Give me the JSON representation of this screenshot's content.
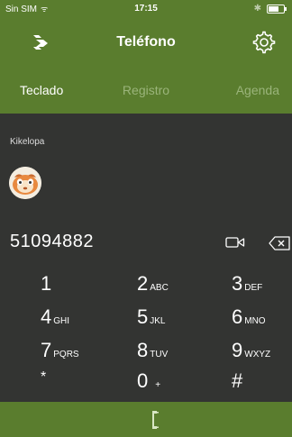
{
  "status_bar": {
    "carrier": "Sin SIM",
    "wifi": "ᯤ",
    "time": "17:15",
    "bluetooth": "✱",
    "battery_level": 0.7
  },
  "header": {
    "title": "Teléfono",
    "logo_icon": "teleoptix-logo-icon",
    "settings_icon": "gear-icon"
  },
  "tabs": [
    {
      "label": "Teclado",
      "active": true
    },
    {
      "label": "Registro",
      "active": false
    },
    {
      "label": "Agenda",
      "active": false
    }
  ],
  "contact": {
    "name": "Kikelopa",
    "avatar_icon": "animal-face-avatar"
  },
  "dialer": {
    "number": "51094882",
    "video_icon": "video-camera-icon",
    "backspace_icon": "backspace-icon"
  },
  "keypad": [
    {
      "digit": "1",
      "letters": ""
    },
    {
      "digit": "2",
      "letters": "ABC"
    },
    {
      "digit": "3",
      "letters": "DEF"
    },
    {
      "digit": "4",
      "letters": "GHI"
    },
    {
      "digit": "5",
      "letters": "JKL"
    },
    {
      "digit": "6",
      "letters": "MNO"
    },
    {
      "digit": "7",
      "letters": "PQRS"
    },
    {
      "digit": "8",
      "letters": "TUV"
    },
    {
      "digit": "9",
      "letters": "WXYZ"
    },
    {
      "digit": "*",
      "letters": ""
    },
    {
      "digit": "0",
      "letters": "+"
    },
    {
      "digit": "#",
      "letters": ""
    }
  ],
  "colors": {
    "brand_green": "#5a7d2e",
    "background": "#333432",
    "inactive_tab": "#9ab47a"
  },
  "bottom": {
    "call_icon": "phone-call-icon"
  }
}
